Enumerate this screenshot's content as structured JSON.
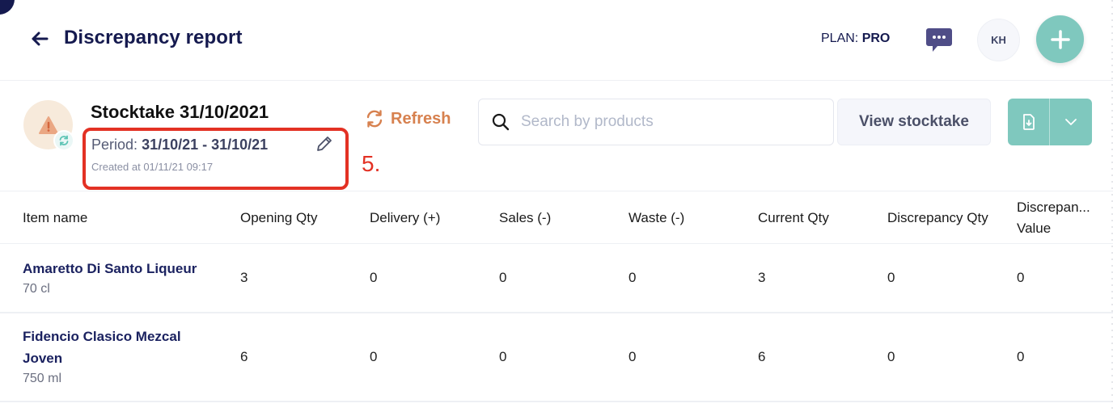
{
  "header": {
    "title": "Discrepancy report",
    "plan_label": "PLAN:",
    "plan_value": "PRO",
    "avatar_initials": "KH",
    "icons": {
      "back": "arrow-left-icon",
      "chat": "chat-bubble-icon",
      "add": "plus-icon"
    }
  },
  "stocktake": {
    "title": "Stocktake 31/10/2021",
    "period_label": "Period:",
    "period_value": "31/10/21 - 31/10/21",
    "created": "Created at 01/11/21 09:17",
    "icons": {
      "status": "warning-icon",
      "sync": "sync-icon",
      "edit": "pencil-icon"
    }
  },
  "annotation": {
    "label": "5.",
    "color": "#e33124"
  },
  "toolbar": {
    "refresh_label": "Refresh",
    "search_placeholder": "Search by products",
    "search_value": "",
    "view_label": "View stocktake",
    "icons": {
      "refresh": "refresh-icon",
      "search": "search-icon",
      "export": "file-download-icon",
      "dropdown": "chevron-down-icon"
    }
  },
  "table": {
    "columns": [
      "Item name",
      "Opening Qty",
      "Delivery (+)",
      "Sales (-)",
      "Waste (-)",
      "Current Qty",
      "Discrepancy Qty",
      "Discrepan... Value"
    ],
    "rows": [
      {
        "name": "Amaretto Di Santo Liqueur",
        "size": "70 cl",
        "opening": "3",
        "delivery": "0",
        "sales": "0",
        "waste": "0",
        "current": "3",
        "discrepancy_qty": "0",
        "discrepancy_value": "0"
      },
      {
        "name": "Fidencio Clasico Mezcal Joven",
        "size": "750 ml",
        "opening": "6",
        "delivery": "0",
        "sales": "0",
        "waste": "0",
        "current": "6",
        "discrepancy_qty": "0",
        "discrepancy_value": "0"
      }
    ]
  },
  "colors": {
    "brand_navy": "#151a4f",
    "accent_teal": "#7fc8be",
    "refresh_orange": "#d7814f",
    "warning_bg": "#f7eadb"
  }
}
